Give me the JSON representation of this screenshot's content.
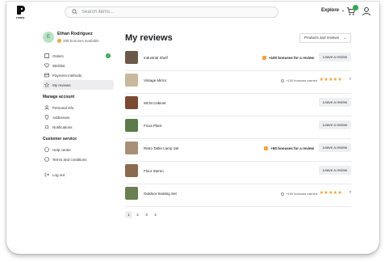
{
  "brand": {
    "logo_text": "rewiz"
  },
  "search": {
    "placeholder": "Search items..."
  },
  "header": {
    "explore_label": "Explore"
  },
  "profile": {
    "initial": "E",
    "name": "Ethan Rodriguez",
    "bonus_text": "358 bonuses available"
  },
  "sidebar": {
    "items": [
      {
        "label": "Orders",
        "icon": "box-icon",
        "badge": "1"
      },
      {
        "label": "Wishlist",
        "icon": "heart-icon"
      },
      {
        "label": "Payment methods",
        "icon": "card-icon"
      },
      {
        "label": "My reviews",
        "icon": "star-icon",
        "active": true
      }
    ],
    "manage_title": "Manage account",
    "manage_items": [
      {
        "label": "Personal info",
        "icon": "user-icon"
      },
      {
        "label": "Addresses",
        "icon": "pin-icon"
      },
      {
        "label": "Notifications",
        "icon": "bell-icon"
      }
    ],
    "service_title": "Customer service",
    "service_items": [
      {
        "label": "Help center",
        "icon": "help-icon"
      },
      {
        "label": "Terms and conditions",
        "icon": "doc-icon"
      }
    ],
    "logout_label": "Log out"
  },
  "main": {
    "title": "My reviews",
    "filter_label": "Products and reviews",
    "leave_label": "Leave a review",
    "reviews": [
      {
        "name": "Industrial Shelf",
        "bonus": "+100 bonuses for a review",
        "thumb": "#6b5a4a"
      },
      {
        "name": "Vintage Mirror",
        "earned": "+100 bonuses earned",
        "rating": 5,
        "thumb": "#c8b89c"
      },
      {
        "name": "MCM Cabinet",
        "thumb": "#7a4a32"
      },
      {
        "name": "Ficus Plant",
        "thumb": "#5c7a4a"
      },
      {
        "name": "Retro Table Lamp Set",
        "bonus": "+60 bonuses for a review",
        "thumb": "#a89078"
      },
      {
        "name": "Floor Stereo",
        "thumb": "#8a6a4e"
      },
      {
        "name": "Outdoor Seating Set",
        "earned": "+100 bonuses earned",
        "rating": 5,
        "thumb": "#6a8050"
      }
    ],
    "pages": [
      "1",
      "2",
      "3",
      "4"
    ],
    "current_page": "1"
  },
  "colors": {
    "accent_green": "#2fa84f",
    "bonus_orange": "#f0a542",
    "star": "#f29b2a"
  }
}
